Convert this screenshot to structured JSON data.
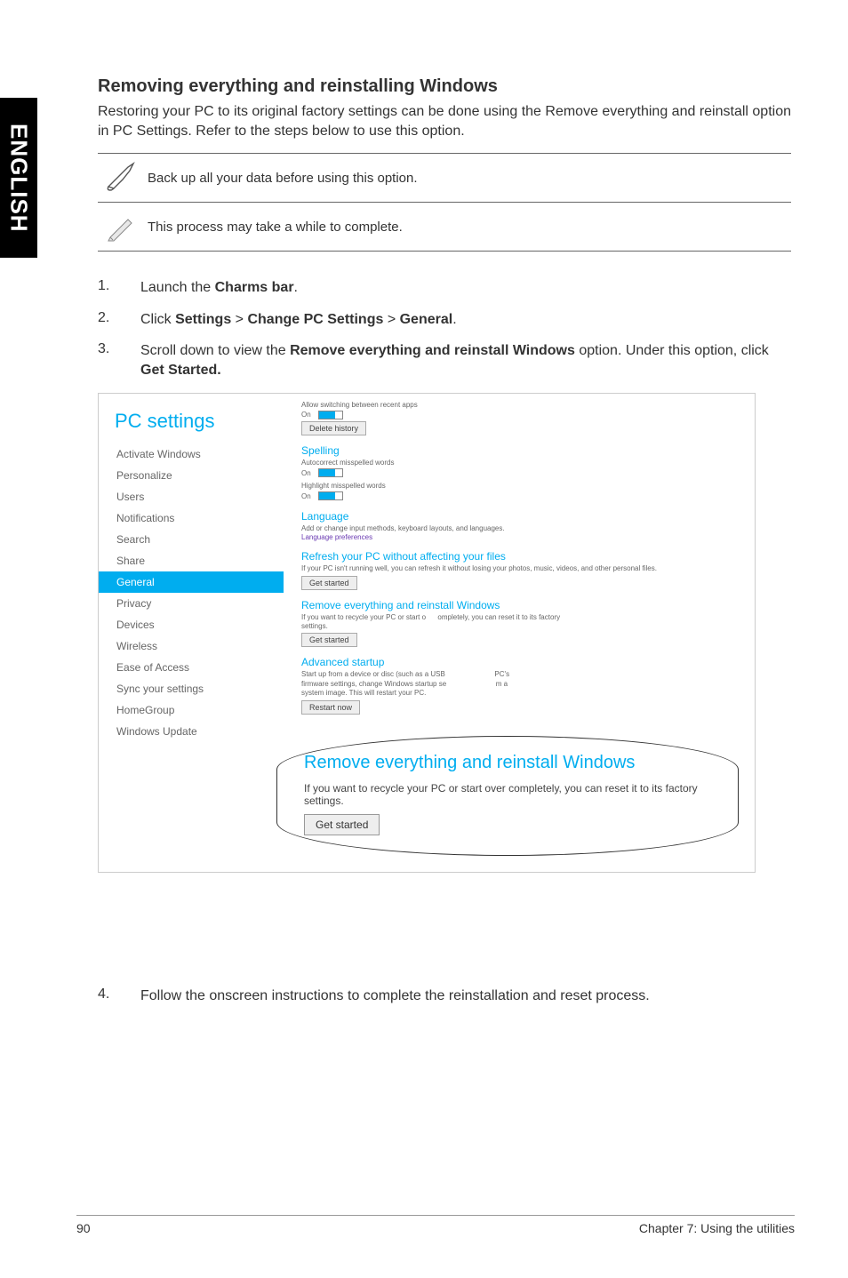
{
  "sideTab": "ENGLISH",
  "heading": "Removing everything and reinstalling Windows",
  "intro": "Restoring your PC to its original factory settings can be done using the Remove everything and reinstall option in PC Settings. Refer to the steps below to use this option.",
  "note1": "Back up all your data before using this option.",
  "note2": "This process may take a while to complete.",
  "step1_num": "1.",
  "step1_a": "Launch the ",
  "step1_b": "Charms bar",
  "step1_c": ".",
  "step2_num": "2.",
  "step2_a": "Click ",
  "step2_b": "Settings",
  "step2_c": " > ",
  "step2_d": "Change PC Settings",
  "step2_e": " > ",
  "step2_f": "General",
  "step2_g": ".",
  "step3_num": "3.",
  "step3_a": "Scroll down to view the ",
  "step3_b": "Remove everything and reinstall Windows",
  "step3_c": " option. Under this option, click ",
  "step3_d": "Get Started.",
  "step4_num": "4.",
  "step4_text": "Follow the onscreen instructions to complete the reinstallation and reset process.",
  "footer_page": "90",
  "footer_chapter": "Chapter 7: Using the utilities",
  "ss": {
    "title": "PC settings",
    "nav": [
      "Activate Windows",
      "Personalize",
      "Users",
      "Notifications",
      "Search",
      "Share",
      "General",
      "Privacy",
      "Devices",
      "Wireless",
      "Ease of Access",
      "Sync your settings",
      "HomeGroup",
      "Windows Update"
    ],
    "switchLine": "Allow switching between recent apps",
    "on": "On",
    "deleteHistory": "Delete history",
    "spelling": "Spelling",
    "autocorrect": "Autocorrect misspelled words",
    "highlight": "Highlight misspelled words",
    "language": "Language",
    "languageDesc": "Add or change input methods, keyboard layouts, and languages.",
    "languageLink": "Language preferences",
    "refresh": "Refresh your PC without affecting your files",
    "refreshDesc": "If your PC isn't running well, you can refresh it without losing your photos, music, videos, and other personal files.",
    "getStarted": "Get started",
    "remove": "Remove everything and reinstall Windows",
    "removeDesc1": "If you want to recycle your PC or start o",
    "removeDesc2": "ompletely, you can reset it to its factory",
    "removeDesc3": "settings.",
    "advanced": "Advanced startup",
    "advancedDesc1": "Start up from a device or disc (such as a USB",
    "advancedDesc2": "PC's",
    "advancedDesc3": "firmware settings, change Windows startup se",
    "advancedDesc4": "m a",
    "advancedDesc5": "system image. This will restart your PC.",
    "restartNow": "Restart now",
    "callout_title": "Remove everything and reinstall Windows",
    "callout_text": "If you want to recycle your PC or start over completely, you can reset it to its factory settings.",
    "callout_btn": "Get started"
  }
}
